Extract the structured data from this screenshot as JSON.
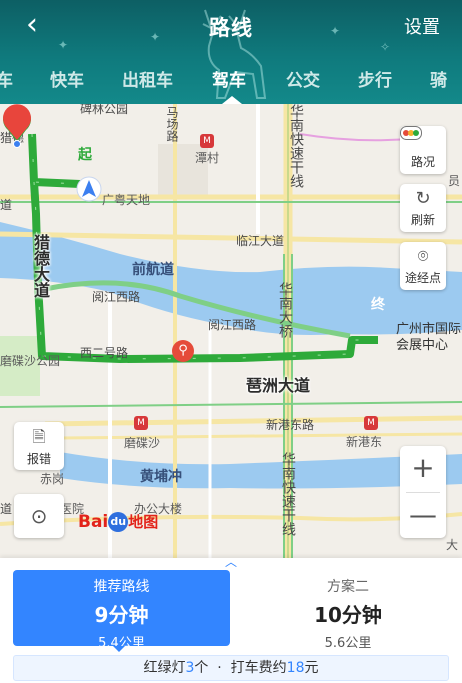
{
  "header": {
    "title": "路线",
    "back_icon": "back-arrow-icon",
    "settings_label": "设置",
    "bg_color": "#0f7a7d"
  },
  "tabs": [
    {
      "label": "车",
      "active": false
    },
    {
      "label": "快车",
      "active": false
    },
    {
      "label": "出租车",
      "active": false
    },
    {
      "label": "驾车",
      "active": true
    },
    {
      "label": "公交",
      "active": false
    },
    {
      "label": "步行",
      "active": false
    },
    {
      "label": "骑",
      "active": false
    }
  ],
  "map": {
    "labels": {
      "liede": "猎德",
      "dao": "道",
      "road_h1": "道",
      "liede_road": "猎德大道",
      "guangyue": "广粤天地",
      "tancun": "潭村",
      "mahchang": "马场路",
      "linjiang": "临江大道",
      "qianhang": "前航道",
      "yuejiang_w1": "阅江西路",
      "yuejiang_w2": "阅江西路",
      "xierhao": "西二号路",
      "huanan_bridge": "华南大桥",
      "huanan_express_top": "华南快速干线",
      "huanan_express_bottom": "华南快速干线",
      "pazhou": "琶洲大道",
      "xingang_dong_road": "新港东路",
      "xingang_dong": "新港东",
      "mosha": "磨碟沙",
      "mosha_park": "磨碟沙公园",
      "huangpu": "黄埔冲",
      "chigang": "赤岗",
      "hospital": "第二医院",
      "office": "办公大楼",
      "top_park": "碑林公园",
      "yuan": "员",
      "da": "大",
      "venue": "广州市国际会展中心"
    },
    "start_label": "起",
    "end_label": "终",
    "route_color": "#2eaa3a",
    "buttons": {
      "traffic": "路况",
      "refresh": "刷新",
      "waypoint": "途经点",
      "report": "报错",
      "locate_icon": "locate-icon",
      "zoom_in": "+",
      "zoom_out": "—"
    },
    "logo": "地图"
  },
  "plans": [
    {
      "name": "推荐路线",
      "time": "9分钟",
      "distance": "5.4公里",
      "active": true
    },
    {
      "name": "方案二",
      "time": "10分钟",
      "distance": "5.6公里",
      "active": false
    }
  ],
  "summary": {
    "traffic_lights_prefix": "红绿灯",
    "traffic_lights_count": "3",
    "traffic_lights_suffix": "个",
    "fare_prefix": "打车费约",
    "fare_amount": "18",
    "fare_suffix": "元"
  }
}
